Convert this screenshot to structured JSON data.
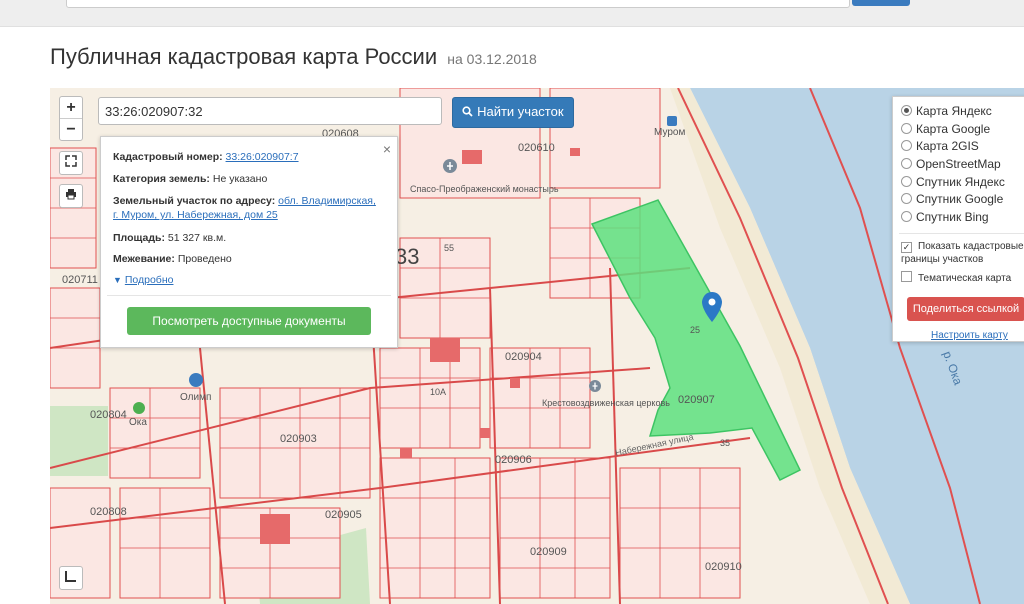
{
  "page": {
    "title": "Публичная кадастровая карта России",
    "date_label": "на 03.12.2018"
  },
  "search": {
    "value": "33:26:020907:32",
    "button_label": "Найти участок",
    "button_icon": "search-icon"
  },
  "controls": {
    "zoom_in": "+",
    "zoom_out": "−",
    "fullscreen_icon": "fullscreen-icon",
    "print_icon": "print-icon",
    "legend_icon": "legend-icon"
  },
  "popup": {
    "close": "×",
    "cadastral_label": "Кадастровый номер:",
    "cadastral_value": "33:26:020907:7",
    "category_label": "Категория земель:",
    "category_value": "Не указано",
    "address_label": "Земельный участок по адресу:",
    "address_value": "обл. Владимирская, г. Муром, ул. Набережная, дом 25",
    "area_label": "Площадь:",
    "area_value": "51 327 кв.м.",
    "survey_label": "Межевание:",
    "survey_value": "Проведено",
    "more_label": "Подробно",
    "docs_button": "Посмотреть доступные документы"
  },
  "layers": {
    "basemaps": [
      {
        "label": "Карта Яндекс",
        "selected": true
      },
      {
        "label": "Карта Google",
        "selected": false
      },
      {
        "label": "Карта 2GIS",
        "selected": false
      },
      {
        "label": "OpenStreetMap",
        "selected": false
      },
      {
        "label": "Спутник Яндекс",
        "selected": false
      },
      {
        "label": "Спутник Google",
        "selected": false
      },
      {
        "label": "Спутник Bing",
        "selected": false
      }
    ],
    "show_borders": "Показать кадастровые границы участков",
    "show_borders_checked": true,
    "thematic": "Тематическая карта",
    "thematic_checked": false,
    "share_button": "Поделиться ссылкой",
    "setup_link": "Настроить карту"
  },
  "map_labels": {
    "quarter_020907": "020907",
    "quarter_020904": "020904",
    "quarter_020903": "020903",
    "quarter_020906": "020906",
    "quarter_020905": "020905",
    "quarter_020909": "020909",
    "quarter_020910": "020910",
    "quarter_020808": "020808",
    "quarter_020804": "020804",
    "quarter_020610": "020610",
    "quarter_020608": "020608",
    "quarter_020711": "020711",
    "district_33": "33",
    "monastery": "Спасо-Преображенский монастырь",
    "church": "Крестовоздвиженская церковь",
    "murom": "Муром",
    "oka_river": "р. Ока",
    "oka_shop": "Ока",
    "olimp": "Олимп",
    "street_embankment": "Набережная улица",
    "parcel_25": "25",
    "parcel_35": "35",
    "parcel_55": "55",
    "parcel_10a": "10А"
  },
  "colors": {
    "parcel_line": "#e05050",
    "selected_parcel": "#5de07f",
    "river": "#b9d3e6",
    "button_blue": "#357ab8",
    "button_green": "#5cb85c",
    "button_red": "#d9534f",
    "pin": "#2b78c6"
  }
}
